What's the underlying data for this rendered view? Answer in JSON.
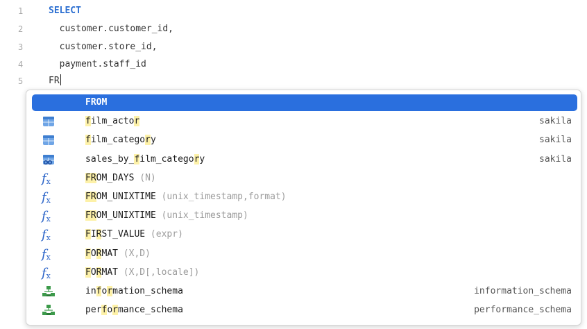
{
  "editor": {
    "lines": [
      {
        "num": "1",
        "text": "SELECT"
      },
      {
        "num": "2",
        "text": "  customer.customer_id,"
      },
      {
        "num": "3",
        "text": "  customer.store_id,"
      },
      {
        "num": "4",
        "text": "  payment.staff_id"
      },
      {
        "num": "5",
        "text": "FR"
      }
    ]
  },
  "autocomplete": {
    "items": [
      {
        "label": "FROM",
        "args": "",
        "right": "",
        "icon": "keyword",
        "selected": true
      },
      {
        "label": "film_actor",
        "args": "",
        "right": "sakila",
        "icon": "table-icon"
      },
      {
        "label": "film_category",
        "args": "",
        "right": "sakila",
        "icon": "table-icon"
      },
      {
        "label": "sales_by_film_category",
        "args": "",
        "right": "sakila",
        "icon": "view-icon"
      },
      {
        "label": "FROM_DAYS",
        "args": "(N)",
        "right": "",
        "icon": "function-icon"
      },
      {
        "label": "FROM_UNIXTIME",
        "args": "(unix_timestamp,format)",
        "right": "",
        "icon": "function-icon"
      },
      {
        "label": "FROM_UNIXTIME",
        "args": "(unix_timestamp)",
        "right": "",
        "icon": "function-icon"
      },
      {
        "label": "FIRST_VALUE",
        "args": "(expr)",
        "right": "",
        "icon": "function-icon"
      },
      {
        "label": "FORMAT",
        "args": "(X,D)",
        "right": "",
        "icon": "function-icon"
      },
      {
        "label": "FORMAT",
        "args": "(X,D[,locale])",
        "right": "",
        "icon": "function-icon"
      },
      {
        "label": "information_schema",
        "args": "",
        "right": "information_schema",
        "icon": "schema-icon"
      },
      {
        "label": "performance_schema",
        "args": "",
        "right": "performance_schema",
        "icon": "schema-icon"
      }
    ]
  },
  "colors": {
    "accent": "#2a6fde",
    "keyword": "#2c6fd1",
    "match_highlight": "#fdf1a8"
  }
}
